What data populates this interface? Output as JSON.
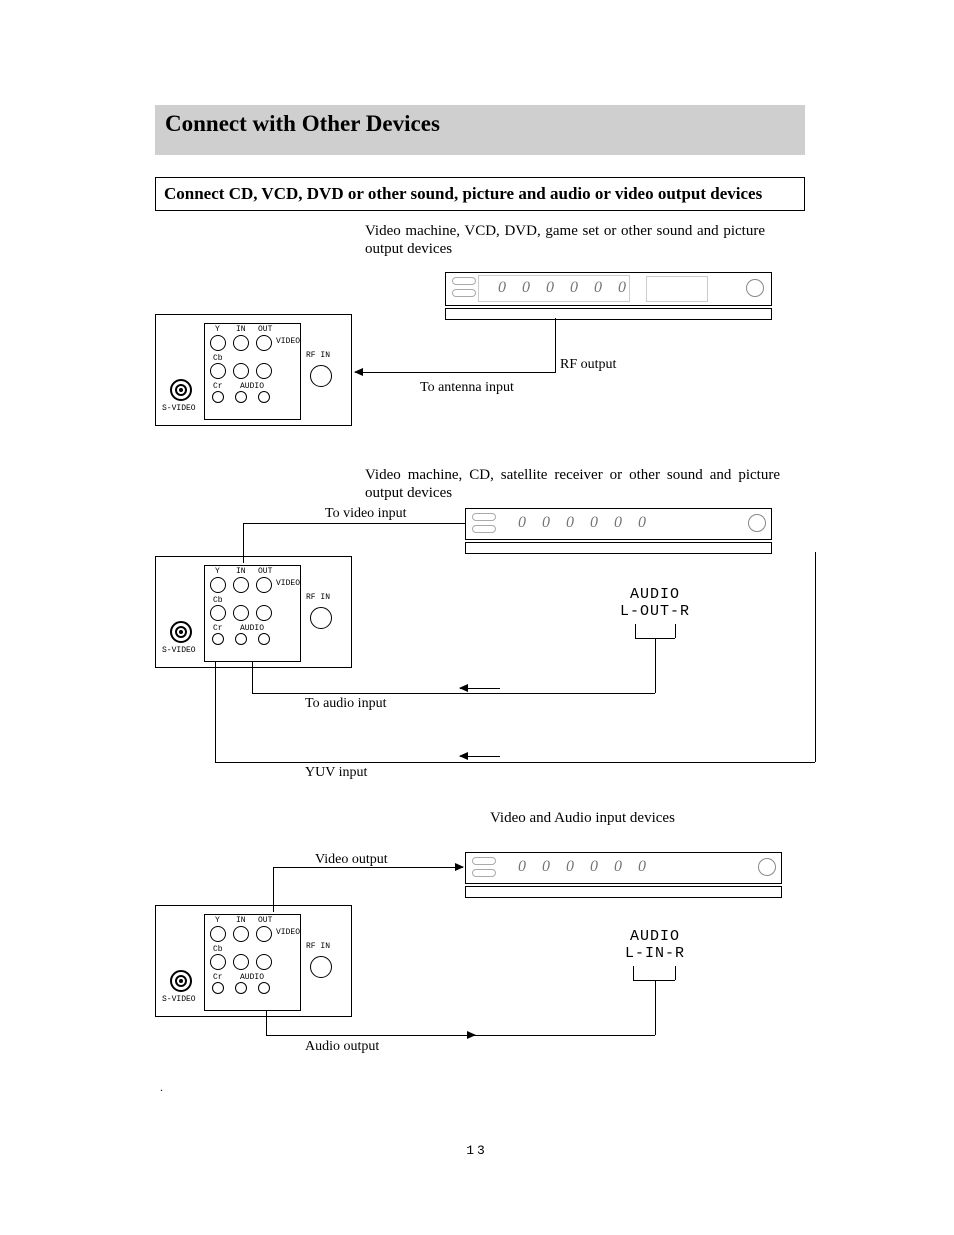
{
  "title": "Connect with Other Devices",
  "subtitle": "Connect CD, VCD, DVD or other sound, picture and audio or video output devices",
  "page_number": "13",
  "captions": {
    "c1": "Video machine, VCD, DVD, game set or other sound and picture output devices",
    "c2": "Video machine, CD, satellite receiver or other sound and picture output devices",
    "c3": "Video and Audio input devices"
  },
  "labels": {
    "rf_output": "RF output",
    "to_antenna": "To antenna input",
    "to_video_input": "To video input",
    "to_audio_input": "To audio input",
    "yuv_input": "YUV input",
    "video_output": "Video output",
    "audio_output": "Audio output",
    "audio": "AUDIO",
    "l_out_r": "L-OUT-R",
    "l_in_r": "L-IN-R",
    "s_video": "S-VIDEO",
    "video": "VIDEO",
    "rf_in": "RF IN",
    "audio_small": "AUDIO",
    "y": "Y",
    "in": "IN",
    "out": "OUT",
    "cb": "Cb",
    "cr": "Cr"
  }
}
